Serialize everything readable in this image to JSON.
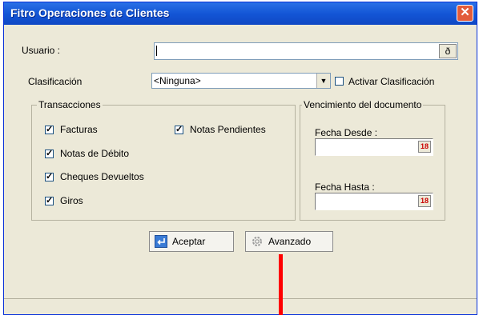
{
  "window": {
    "title": "Fitro Operaciones de Clientes"
  },
  "form": {
    "usuario_label": "Usuario :",
    "clasificacion_label": "Clasificación",
    "clasificacion_value": "<Ninguna>",
    "activar_label": "Activar Clasificación"
  },
  "transacciones": {
    "legend": "Transacciones",
    "items": [
      "Facturas",
      "Notas Pendientes",
      "Notas de Débito",
      "Cheques Devueltos",
      "Giros"
    ]
  },
  "vencimiento": {
    "legend": "Vencimiento del documento",
    "desde_label": "Fecha Desde :",
    "hasta_label": "Fecha Hasta :"
  },
  "buttons": {
    "aceptar": "Aceptar",
    "avanzado": "Avanzado"
  },
  "colors": {
    "titlebar": "#1356d6",
    "close": "#e25b3a",
    "annotation": "#ff0000"
  }
}
